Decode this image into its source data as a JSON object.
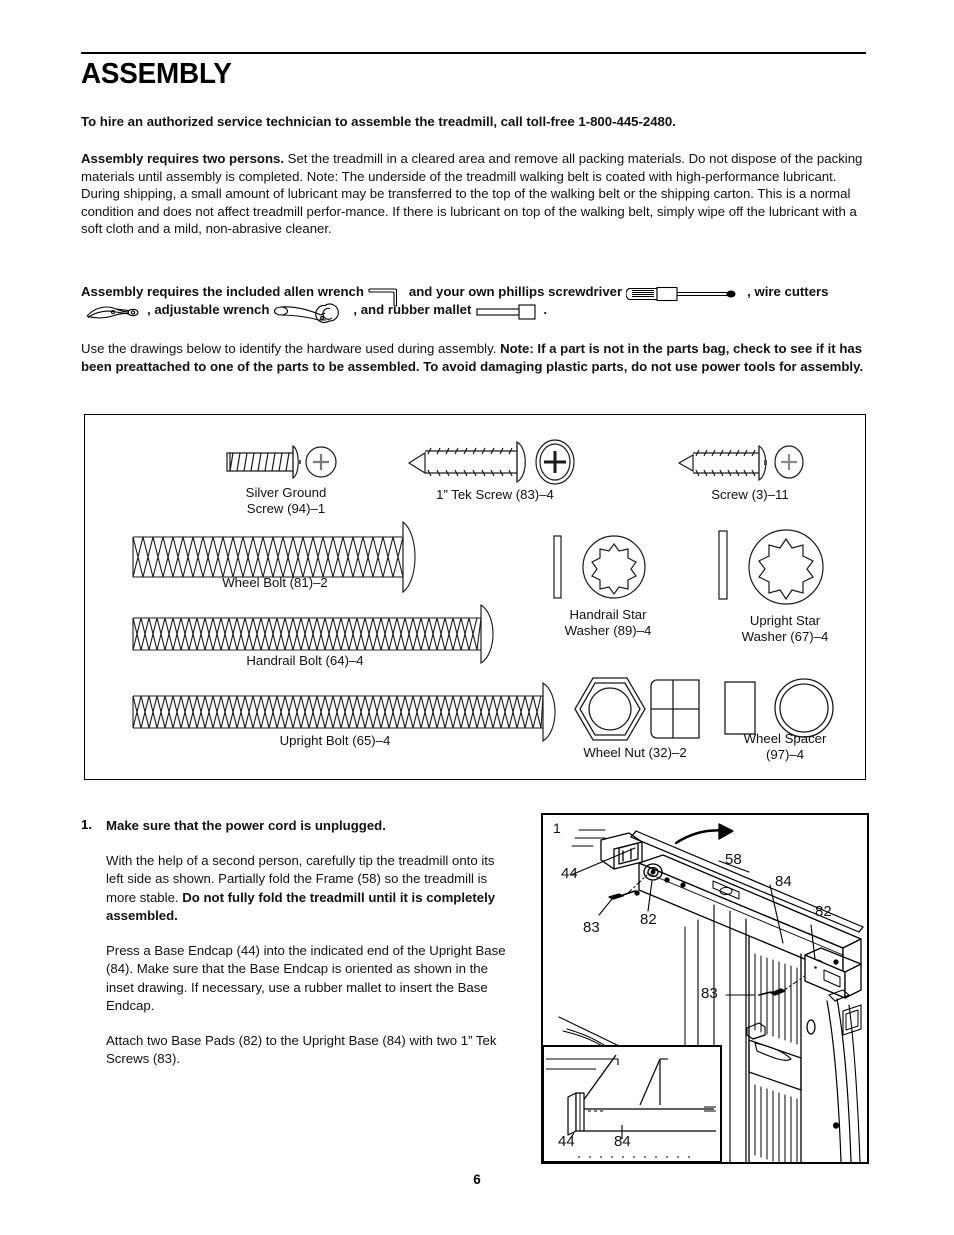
{
  "header": {
    "title": "ASSEMBLY"
  },
  "intro": {
    "service_line": "To hire an authorized service technician to assemble the treadmill, call toll-free 1-800-445-2480.",
    "two_persons_bold": "Assembly requires two persons.",
    "two_persons_rest": " Set the treadmill in a cleared area and remove all packing materials. Do not dispose of the packing materials until assembly is completed. Note: The underside of the treadmill walking belt is coated with high-performance lubricant. During shipping, a small amount of lubricant may be transferred to the top of the walking belt or the shipping carton. This is a normal condition and does not affect treadmill perfor-mance. If there is lubricant on top of the walking belt, simply wipe off the lubricant with a soft cloth and a mild, non-abrasive cleaner.",
    "tools_part1": "Assembly requires the included allen wrench",
    "tools_part2": "and your own phillips screwdriver",
    "tools_part3": ", wire cutters",
    "tools_part4": ", adjustable wrench",
    "tools_part5": ", and rubber mallet",
    "tools_part6": ".",
    "use_drawings_plain": "Use the drawings below to identify the hardware used during assembly. ",
    "use_drawings_bold": "Note: If a part is not in the parts bag, check to see if it has been preattached to one of the parts to be assembled. To avoid damaging plastic parts, do not use power tools for assembly."
  },
  "tool_icons": [
    {
      "name": "allen-wrench-icon",
      "label": "allen wrench"
    },
    {
      "name": "phillips-screwdriver-icon",
      "label": "phillips screwdriver"
    },
    {
      "name": "wire-cutters-icon",
      "label": "wire cutters"
    },
    {
      "name": "adjustable-wrench-icon",
      "label": "adjustable wrench"
    },
    {
      "name": "rubber-mallet-icon",
      "label": "rubber mallet"
    }
  ],
  "hardware": {
    "parts": [
      {
        "id": "silver-ground-screw",
        "caption": "Silver Ground\nScrew (94)–1",
        "part_number": "94",
        "quantity": "1",
        "type": "screw"
      },
      {
        "id": "tek-screw",
        "caption": "1” Tek Screw (83)–4",
        "part_number": "83",
        "quantity": "4",
        "type": "screw"
      },
      {
        "id": "screw-3",
        "caption": "Screw (3)–11",
        "part_number": "3",
        "quantity": "11",
        "type": "screw"
      },
      {
        "id": "wheel-bolt",
        "caption": "Wheel Bolt (81)–2",
        "part_number": "81",
        "quantity": "2",
        "type": "bolt"
      },
      {
        "id": "handrail-bolt",
        "caption": "Handrail Bolt (64)–4",
        "part_number": "64",
        "quantity": "4",
        "type": "bolt"
      },
      {
        "id": "upright-bolt",
        "caption": "Upright Bolt (65)–4",
        "part_number": "65",
        "quantity": "4",
        "type": "bolt"
      },
      {
        "id": "handrail-star-washer",
        "caption": "Handrail Star\nWasher (89)–4",
        "part_number": "89",
        "quantity": "4",
        "type": "star-washer"
      },
      {
        "id": "upright-star-washer",
        "caption": "Upright Star\nWasher (67)–4",
        "part_number": "67",
        "quantity": "4",
        "type": "star-washer"
      },
      {
        "id": "wheel-nut",
        "caption": "Wheel Nut (32)–2",
        "part_number": "32",
        "quantity": "2",
        "type": "nut"
      },
      {
        "id": "wheel-spacer",
        "caption": "Wheel Spacer\n(97)–4",
        "part_number": "97",
        "quantity": "4",
        "type": "spacer"
      }
    ]
  },
  "step": {
    "number": "1.",
    "heading": "Make sure that the power cord is unplugged.",
    "para2_a": "With the help of a second person, carefully tip the treadmill onto its left side as shown. Partially fold the Frame (58) so the treadmill is more stable. ",
    "para2_b": "Do not fully fold the treadmill until it is completely assembled.",
    "para3": "Press a Base Endcap (44) into the indicated end of the Upright Base (84). Make sure that the Base Endcap is oriented as shown in the inset drawing. If necessary, use a rubber mallet to insert the Base Endcap.",
    "para4": "Attach two Base Pads (82) to the Upright Base (84) with two 1” Tek Screws (83)."
  },
  "figure": {
    "number": "1",
    "callouts": [
      {
        "id": "callout-44",
        "text": "44"
      },
      {
        "id": "callout-83-left",
        "text": "83"
      },
      {
        "id": "callout-82-left",
        "text": "82"
      },
      {
        "id": "callout-58",
        "text": "58"
      },
      {
        "id": "callout-84",
        "text": "84"
      },
      {
        "id": "callout-82-right",
        "text": "82"
      },
      {
        "id": "callout-83-right",
        "text": "83"
      }
    ],
    "inset_callouts": [
      {
        "id": "inset-callout-44",
        "text": "44"
      },
      {
        "id": "inset-callout-84",
        "text": "84"
      }
    ]
  },
  "footer": {
    "page_number": "6"
  },
  "colors": {
    "ink": "#000000",
    "text": "#111111",
    "paper": "#ffffff"
  }
}
